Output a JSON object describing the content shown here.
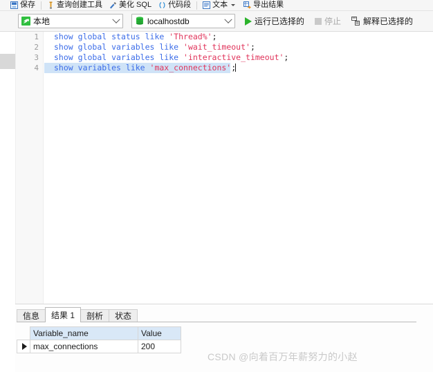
{
  "toolbar_top": {
    "items": [
      {
        "label": "保存",
        "icon": "save-icon"
      },
      {
        "label": "查询创建工具",
        "icon": "query-builder-icon"
      },
      {
        "label": "美化 SQL",
        "icon": "beautify-sql-icon"
      },
      {
        "label": "代码段",
        "icon": "code-snippet-icon"
      },
      {
        "label": "文本",
        "icon": "text-icon"
      },
      {
        "label": "导出结果",
        "icon": "export-result-icon"
      }
    ]
  },
  "toolbar_second": {
    "connection": {
      "value": "本地",
      "icon": "mysql-dolphin-icon"
    },
    "database": {
      "value": "localhostdb",
      "icon": "database-icon"
    },
    "run_label": "运行已选择的",
    "stop_label": "停止",
    "explain_label": "解释已选择的"
  },
  "editor": {
    "line_numbers": [
      "1",
      "2",
      "3",
      "4"
    ],
    "lines": [
      {
        "number": "1",
        "selected": false,
        "tokens": [
          {
            "t": "kw",
            "v": "show"
          },
          {
            "t": "pun",
            "v": " "
          },
          {
            "t": "kw",
            "v": "global"
          },
          {
            "t": "pun",
            "v": " "
          },
          {
            "t": "kw",
            "v": "status"
          },
          {
            "t": "pun",
            "v": " "
          },
          {
            "t": "kw",
            "v": "like"
          },
          {
            "t": "pun",
            "v": " "
          },
          {
            "t": "str",
            "v": "'Thread%'"
          },
          {
            "t": "pun",
            "v": ";"
          }
        ]
      },
      {
        "number": "2",
        "selected": false,
        "tokens": [
          {
            "t": "kw",
            "v": "show"
          },
          {
            "t": "pun",
            "v": " "
          },
          {
            "t": "kw",
            "v": "global"
          },
          {
            "t": "pun",
            "v": " "
          },
          {
            "t": "kw",
            "v": "variables"
          },
          {
            "t": "pun",
            "v": " "
          },
          {
            "t": "kw",
            "v": "like"
          },
          {
            "t": "pun",
            "v": " "
          },
          {
            "t": "str",
            "v": "'wait_timeout'"
          },
          {
            "t": "pun",
            "v": ";"
          }
        ]
      },
      {
        "number": "3",
        "selected": false,
        "tokens": [
          {
            "t": "kw",
            "v": "show"
          },
          {
            "t": "pun",
            "v": " "
          },
          {
            "t": "kw",
            "v": "global"
          },
          {
            "t": "pun",
            "v": " "
          },
          {
            "t": "kw",
            "v": "variables"
          },
          {
            "t": "pun",
            "v": " "
          },
          {
            "t": "kw",
            "v": "like"
          },
          {
            "t": "pun",
            "v": " "
          },
          {
            "t": "str",
            "v": "'interactive_timeout'"
          },
          {
            "t": "pun",
            "v": ";"
          }
        ]
      },
      {
        "number": "4",
        "selected": true,
        "tokens": [
          {
            "t": "kw",
            "v": "show"
          },
          {
            "t": "pun",
            "v": " "
          },
          {
            "t": "kw",
            "v": "variables"
          },
          {
            "t": "pun",
            "v": " "
          },
          {
            "t": "kw",
            "v": "like"
          },
          {
            "t": "pun",
            "v": " "
          },
          {
            "t": "str",
            "v": "'max_connections'"
          },
          {
            "t": "pun",
            "v": ";"
          }
        ]
      }
    ]
  },
  "results": {
    "tabs": [
      {
        "label": "信息",
        "active": false
      },
      {
        "label": "结果 1",
        "active": true
      },
      {
        "label": "剖析",
        "active": false
      },
      {
        "label": "状态",
        "active": false
      }
    ],
    "columns": [
      "Variable_name",
      "Value"
    ],
    "rows": [
      {
        "current": true,
        "cells": [
          "max_connections",
          "200"
        ]
      }
    ]
  },
  "watermark": {
    "text": "CSDN @向着百万年薪努力的小赵"
  },
  "colors": {
    "accent_green": "#2bb32b",
    "keyword_blue": "#3b6ce8",
    "string_red": "#e0335a",
    "selection_blue": "#cfe3f7",
    "header_blue": "#d9e8f7"
  }
}
